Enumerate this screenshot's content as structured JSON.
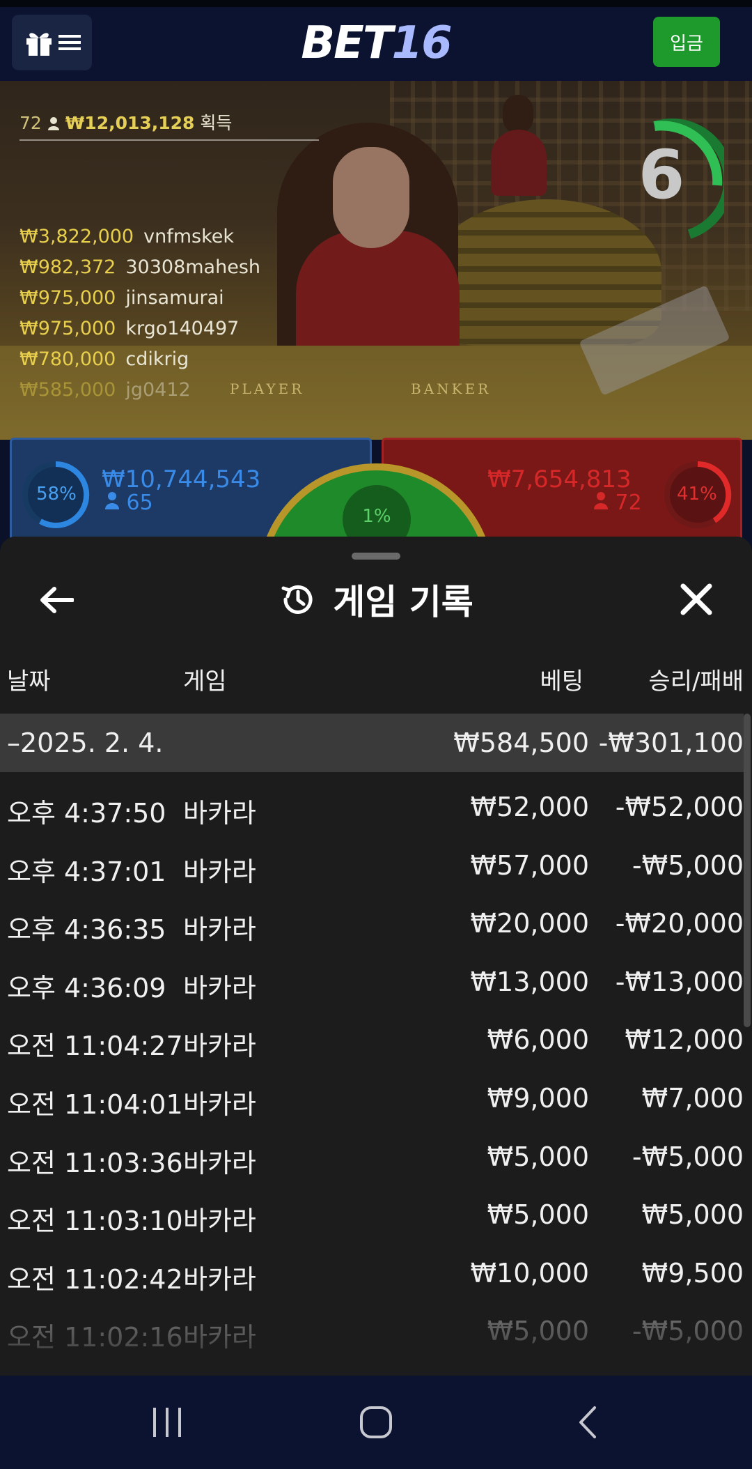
{
  "header": {
    "logo_bet": "BET",
    "logo_num": "16",
    "deposit_label": "입금",
    "menu_icons": [
      "gift-icon",
      "hamburger-icon"
    ]
  },
  "live": {
    "winner_count": "72",
    "winners_total": "₩12,013,128",
    "winners_suffix": "획득",
    "winners": [
      {
        "amount": "₩3,822,000",
        "name": "vnfmskek"
      },
      {
        "amount": "₩982,372",
        "name": "30308mahesh"
      },
      {
        "amount": "₩975,000",
        "name": "jinsamurai"
      },
      {
        "amount": "₩975,000",
        "name": "krgo140497"
      },
      {
        "amount": "₩780,000",
        "name": "cdikrig"
      },
      {
        "amount": "₩585,000",
        "name": "jg0412"
      }
    ],
    "timer": "6",
    "table_player": "PLAYER",
    "table_banker": "BANKER",
    "player_pct": "58%",
    "player_amount": "₩10,744,543",
    "player_count": "65",
    "tie_pct": "1%",
    "banker_amount": "₩7,654,813",
    "banker_count": "72",
    "banker_pct": "41%",
    "colors": {
      "player": "#2d6fd0",
      "banker": "#d42a2a",
      "tie": "#1f8a2a",
      "gold": "#e8cf4c"
    }
  },
  "history": {
    "title": "게임 기록",
    "columns": {
      "date": "날짜",
      "game": "게임",
      "bet": "베팅",
      "result": "승리/패배"
    },
    "group": {
      "date": "–2025. 2. 4.",
      "bet": "₩584,500",
      "result": "-₩301,100"
    },
    "rows": [
      {
        "time": "오후 4:37:50",
        "game": "바카라",
        "bet": "₩52,000",
        "result": "-₩52,000"
      },
      {
        "time": "오후 4:37:01",
        "game": "바카라",
        "bet": "₩57,000",
        "result": "-₩5,000"
      },
      {
        "time": "오후 4:36:35",
        "game": "바카라",
        "bet": "₩20,000",
        "result": "-₩20,000"
      },
      {
        "time": "오후 4:36:09",
        "game": "바카라",
        "bet": "₩13,000",
        "result": "-₩13,000"
      },
      {
        "time": "오전 11:04:27",
        "game": "바카라",
        "bet": "₩6,000",
        "result": "₩12,000"
      },
      {
        "time": "오전 11:04:01",
        "game": "바카라",
        "bet": "₩9,000",
        "result": "₩7,000"
      },
      {
        "time": "오전 11:03:36",
        "game": "바카라",
        "bet": "₩5,000",
        "result": "-₩5,000"
      },
      {
        "time": "오전 11:03:10",
        "game": "바카라",
        "bet": "₩5,000",
        "result": "₩5,000"
      },
      {
        "time": "오전 11:02:42",
        "game": "바카라",
        "bet": "₩10,000",
        "result": "₩9,500"
      },
      {
        "time": "오전 11:02:16",
        "game": "바카라",
        "bet": "₩5,000",
        "result": "-₩5,000"
      }
    ]
  },
  "nav": {
    "icons": [
      "recent-apps-icon",
      "home-icon",
      "back-icon"
    ]
  }
}
